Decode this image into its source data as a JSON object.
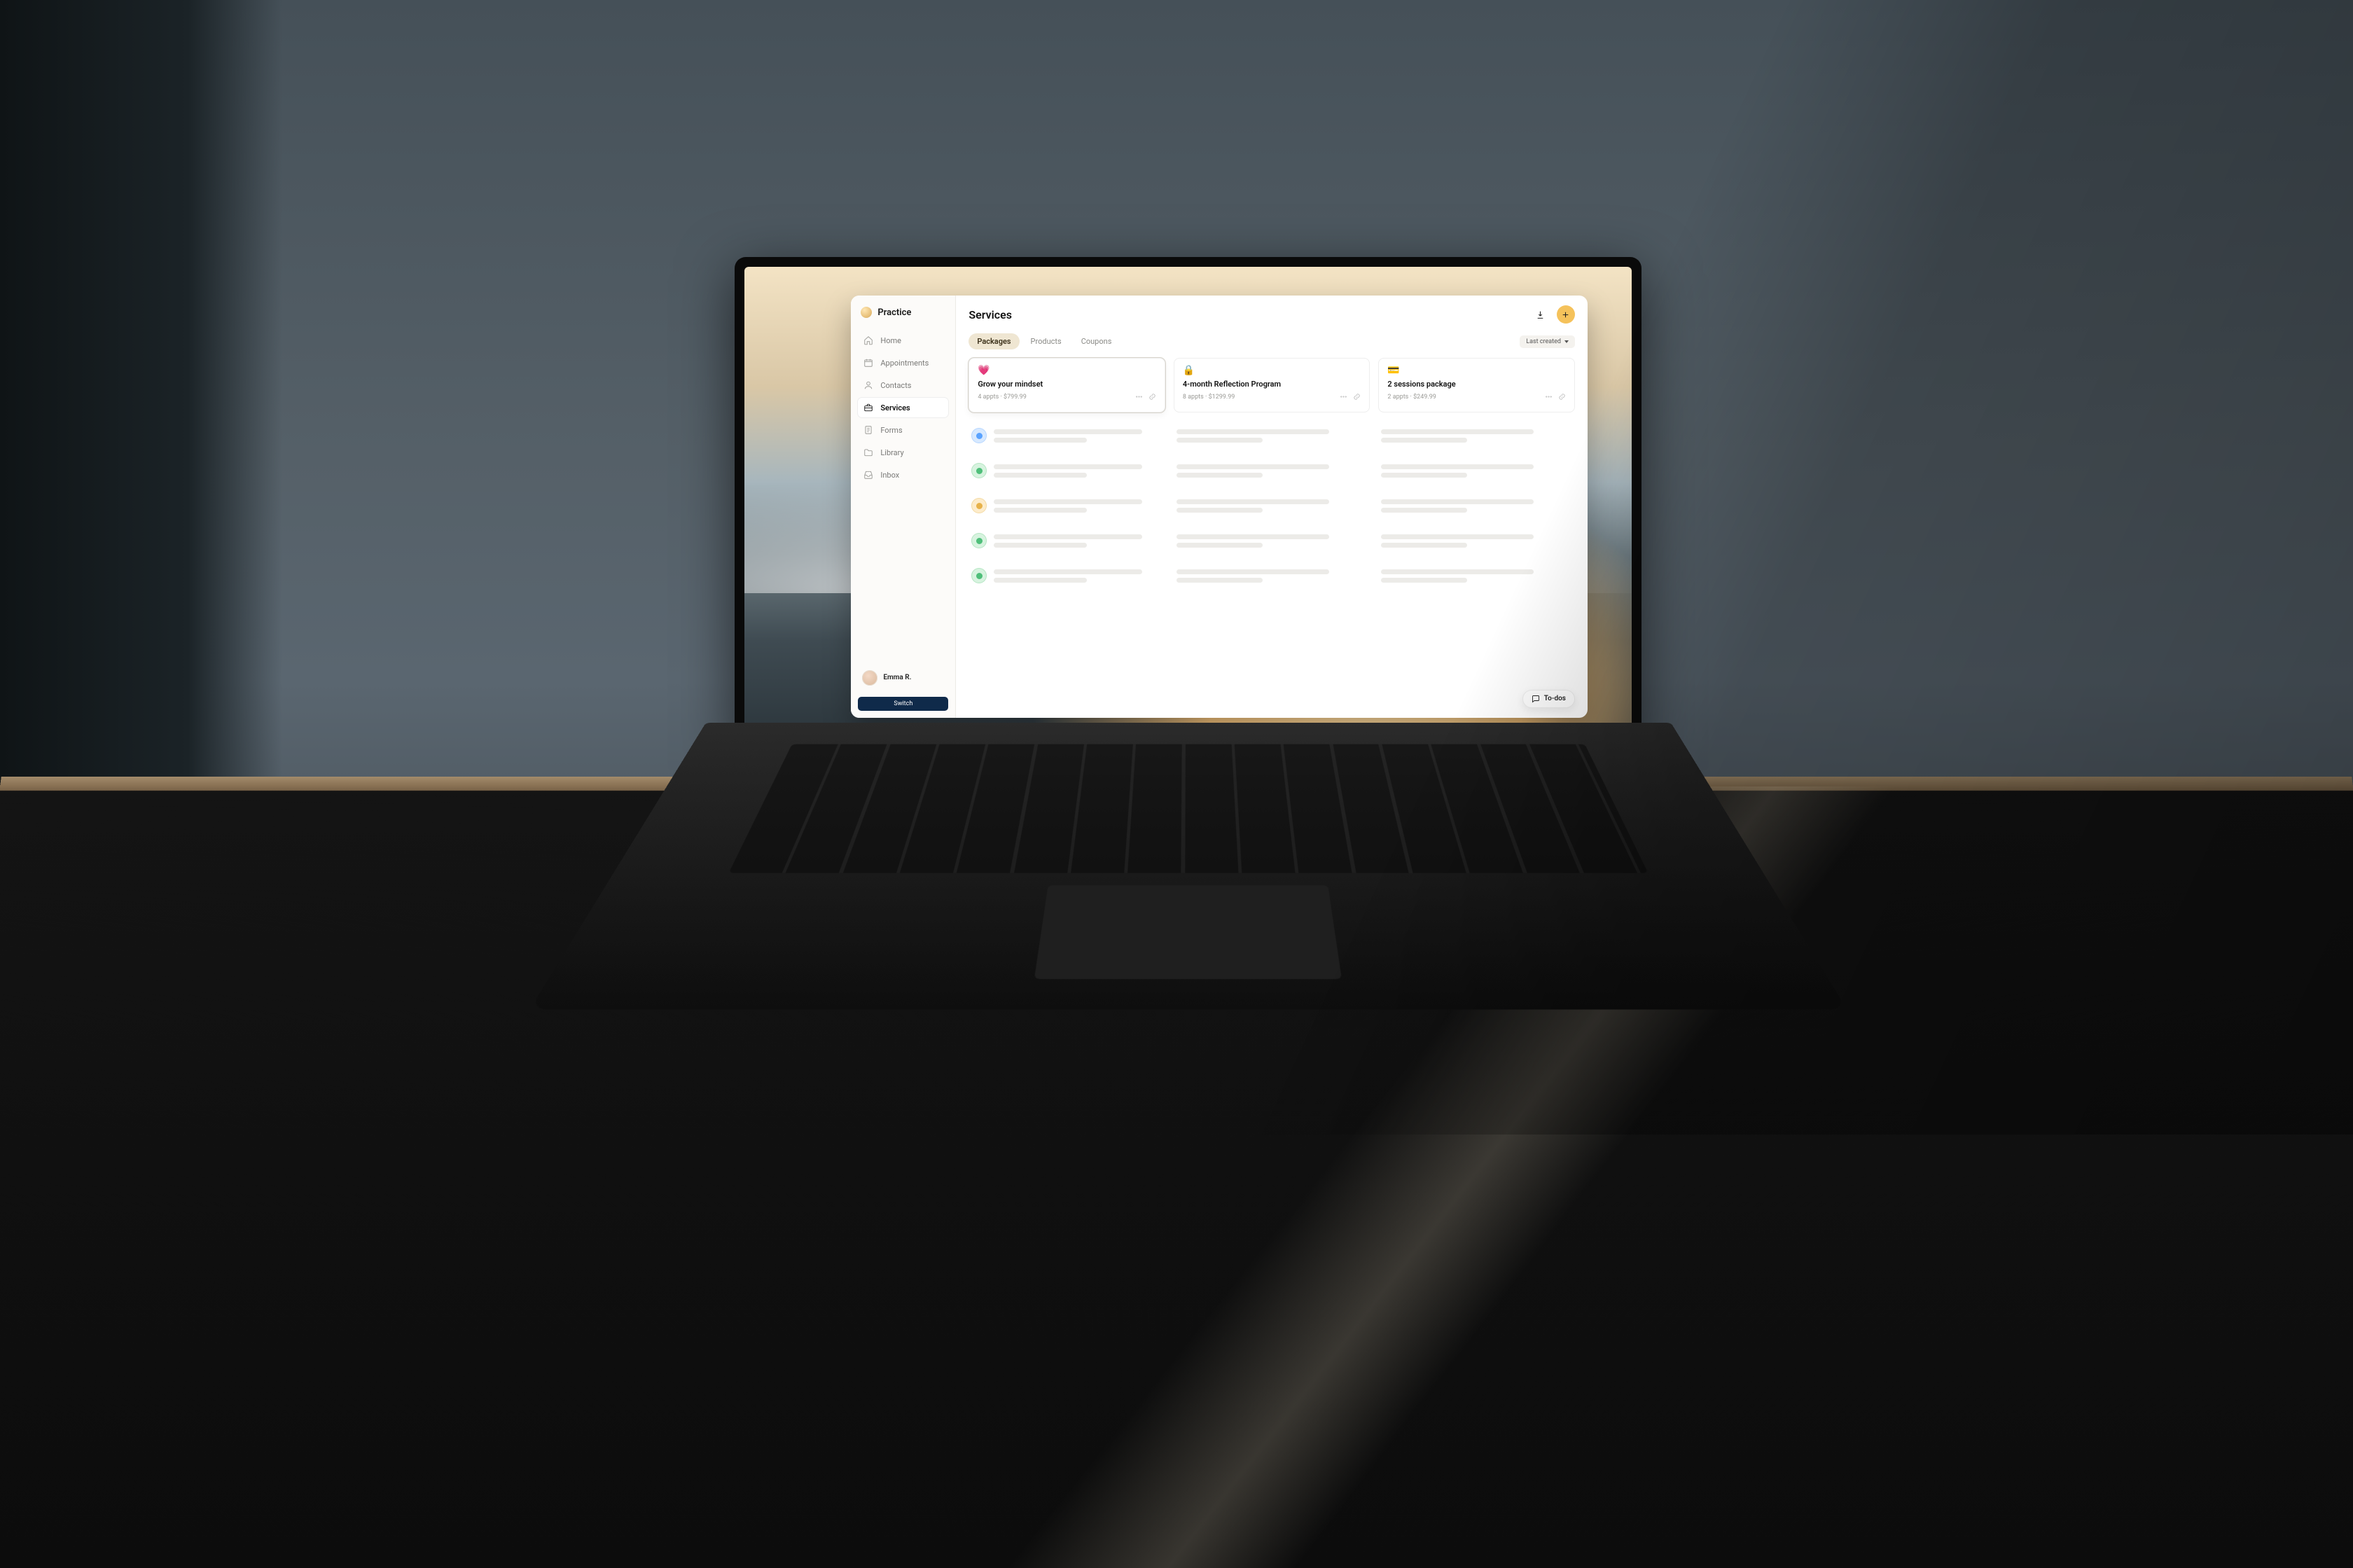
{
  "brand": {
    "name": "Practice"
  },
  "sidebar": {
    "items": [
      {
        "label": "Home"
      },
      {
        "label": "Appointments"
      },
      {
        "label": "Contacts"
      },
      {
        "label": "Services"
      },
      {
        "label": "Forms"
      },
      {
        "label": "Library"
      },
      {
        "label": "Inbox"
      }
    ],
    "active_index": 3,
    "user": {
      "name": "Emma R.",
      "subtitle": ""
    },
    "switch_label": "Switch"
  },
  "header": {
    "title": "Services",
    "actions": {
      "download_icon": "download-icon",
      "add_icon": "plus-icon"
    }
  },
  "tabs": {
    "items": [
      {
        "label": "Packages"
      },
      {
        "label": "Products"
      },
      {
        "label": "Coupons"
      }
    ],
    "active_index": 0
  },
  "sort": {
    "label": "Last created"
  },
  "cards": [
    {
      "icon": "💗",
      "title": "Grow your mindset",
      "meta": "4 appts · $799.99"
    },
    {
      "icon": "🔒",
      "title": "4-month Reflection Program",
      "meta": "8 appts · $1299.99"
    },
    {
      "icon": "💳",
      "title": "2 sessions package",
      "meta": "2 appts · $249.99"
    }
  ],
  "todos": {
    "label": "To-dos"
  },
  "colors": {
    "accent": "#f5c25b",
    "tab_active_bg": "#efe6d2",
    "switch_bg": "#0f2a4a"
  }
}
